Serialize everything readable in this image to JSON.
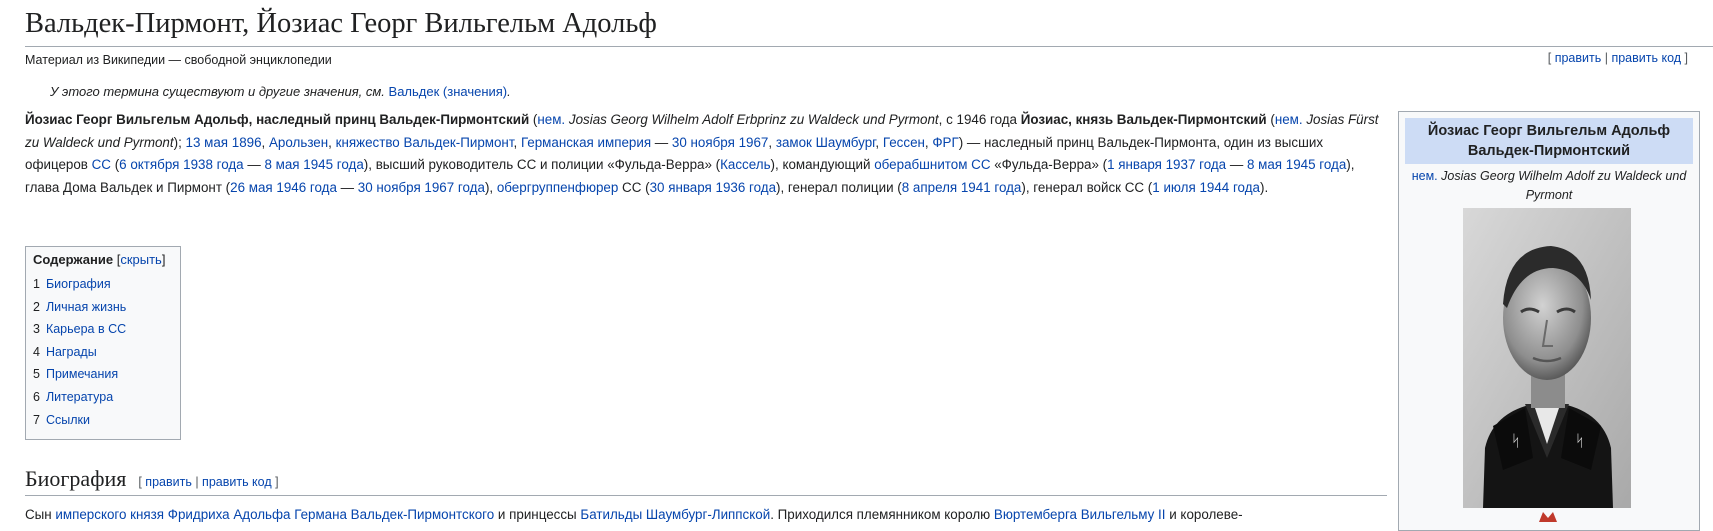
{
  "page": {
    "title": "Вальдек-Пирмонт, Йозиас Георг Вильгельм Адольф",
    "tagline": "Материал из Википедии — свободной энциклопедии",
    "edit_links": {
      "open": "[ ",
      "edit": "править",
      "sep": " | ",
      "edit_code": "править код",
      "close": " ]"
    }
  },
  "hatnote": {
    "text": "У этого термина существуют и другие значения, см. ",
    "link": "Вальдек (значения)",
    "end": "."
  },
  "lead": {
    "b1": "Йозиас Георг Вильгельм Адольф, наследный принц Вальдек-Пирмонтский",
    "t1": " (",
    "l_nem1": "нем.",
    "i1": " Josias Georg Wilhelm Adolf Erbprinz zu Waldeck und Pyrmont",
    "t2": ", с 1946 года ",
    "b2": "Йозиас, князь Вальдек-Пирмонтский",
    "t3": " (",
    "l_nem2": "нем.",
    "i2": " Josias Fürst zu Waldeck und Pyrmont",
    "t4": "); ",
    "l_birth": "13 мая 1896",
    "t5": ", ",
    "l_arolsen": "Арользен",
    "t6": ", ",
    "l_principality": "княжество Вальдек-Пирмонт",
    "t7": ", ",
    "l_empire": "Германская империя",
    "t8": " — ",
    "l_death": "30 ноября 1967",
    "t9": ", ",
    "l_castle": "замок Шаумбург",
    "t10": ", ",
    "l_hessen": "Гессен",
    "t11": ", ",
    "l_frg": "ФРГ",
    "t12": ") — наследный принц Вальдек-Пирмонта, один из высших офицеров ",
    "l_ss1": "СС",
    "t13": " (",
    "l_d1": "6 октября 1938 года",
    "t14": " — ",
    "l_d2": "8 мая 1945 года",
    "t15": "), высший руководитель СС и полиции «Фульда-Верра» (",
    "l_kassel": "Кассель",
    "t16": "), командующий ",
    "l_oberab": "оберабшнитом СС",
    "t17": " «Фульда-Верра» (",
    "l_d3": "1 января 1937 года",
    "t18": " — ",
    "l_d4": "8 мая 1945 года",
    "t19": "), глава Дома Вальдек и Пирмонт (",
    "l_d5": "26 мая 1946 года",
    "t20": " — ",
    "l_d6": "30 ноября 1967 года",
    "t21": "), ",
    "l_ogf": "обергруппенфюрер",
    "t22": " СС (",
    "l_d7": "30 января 1936 года",
    "t23": "), генерал полиции (",
    "l_d8": "8 апреля 1941 года",
    "t24": "), генерал войск СС (",
    "l_d9": "1 июля 1944 года",
    "t25": ")."
  },
  "toc": {
    "title": "Содержание",
    "toggle_open": " [",
    "toggle": "скрыть",
    "toggle_close": "]",
    "items": [
      {
        "num": "1",
        "label": "Биография"
      },
      {
        "num": "2",
        "label": "Личная жизнь"
      },
      {
        "num": "3",
        "label": "Карьера в СС"
      },
      {
        "num": "4",
        "label": "Награды"
      },
      {
        "num": "5",
        "label": "Примечания"
      },
      {
        "num": "6",
        "label": "Литература"
      },
      {
        "num": "7",
        "label": "Ссылки"
      }
    ]
  },
  "section_bio": {
    "heading": "Биография",
    "edit_open": "[ ",
    "edit": "править",
    "sep": " | ",
    "edit_code": "править код",
    "edit_close": " ]",
    "p_t1": "Сын ",
    "p_l1": "имперского князя Фридриха Адольфа Германа Вальдек-Пирмонтского",
    "p_t2": " и принцессы ",
    "p_l2": "Батильды Шаумбург-Липпской",
    "p_t3": ". Приходился племянником королю ",
    "p_l3": "Вюртемберга Вильгельму II",
    "p_t4": " и королеве-"
  },
  "infobox": {
    "title": "Йозиас Георг Вильгельм Адольф Вальдек-Пирмонтский",
    "nem": "нем.",
    "native_name": " Josias Georg Wilhelm Adolf zu Waldeck und Pyrmont"
  },
  "colors": {
    "link": "#0645ad",
    "text": "#202122",
    "border": "#a2a9b1",
    "infobox_header": "#cddcf5"
  }
}
